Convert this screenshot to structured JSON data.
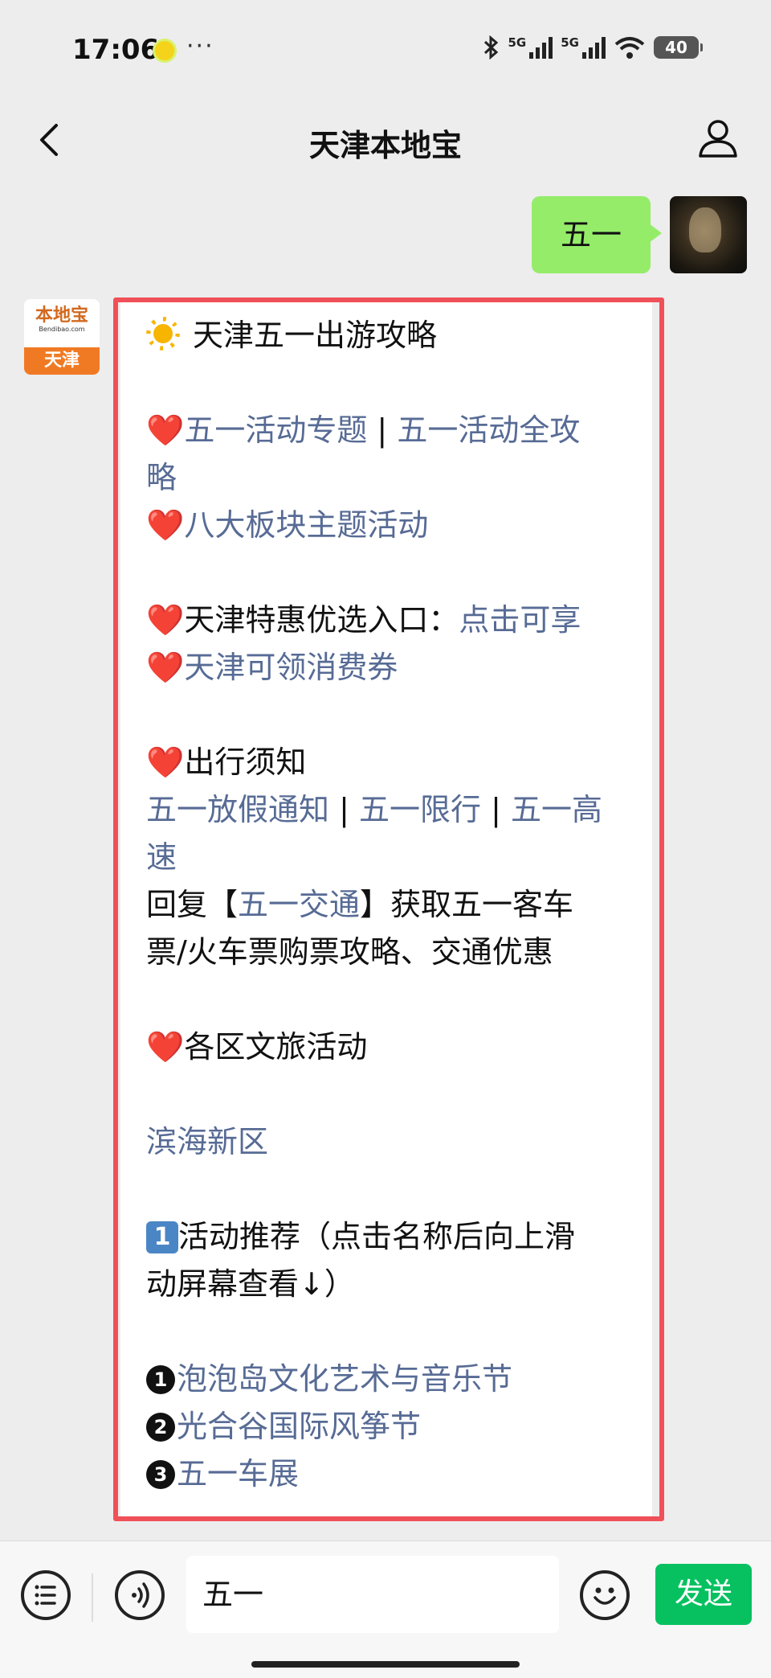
{
  "status_bar": {
    "time": "17:06",
    "network_1": "5G",
    "network_2": "5G",
    "battery": "40"
  },
  "navbar": {
    "title": "天津本地宝"
  },
  "chat": {
    "sent_message": "五一",
    "bot_avatar": {
      "logo_text": "本地宝",
      "url_text": "Bendibao.com",
      "city": "天津"
    },
    "reply": {
      "title": "天津五一出游攻略",
      "heart_glyph": "❤️",
      "topic_link": "五一活动专题",
      "separator": " | ",
      "guide_link_a": "五一活动全攻",
      "guide_link_b": "略",
      "eight_blocks_link": "八大板块主题活动",
      "discount_label": "天津特惠优选入口：",
      "discount_link": "点击可享",
      "coupon_link": "天津可领消费券",
      "travel_notice_label": "出行须知",
      "holiday_notice_link": "五一放假通知",
      "limit_link": "五一限行",
      "highway_link_a": "五一高",
      "highway_link_b": "速",
      "reply_prefix": "回复【",
      "reply_keyword": "五一交通",
      "reply_suffix_a": "】获取五一客车",
      "reply_suffix_b": "票/火车票购票攻略、交通优惠",
      "district_label": "各区文旅活动",
      "district_link": "滨海新区",
      "keycap_num": "1",
      "recommend_a": "活动推荐（点击名称后向上滑",
      "recommend_b": "动屏幕查看↓）",
      "items": [
        {
          "num": "1",
          "label": "泡泡岛文化艺术与音乐节"
        },
        {
          "num": "2",
          "label": "光合谷国际风筝节"
        },
        {
          "num": "3",
          "label": "五一车展"
        }
      ]
    }
  },
  "input_bar": {
    "text_value": "五一",
    "send_label": "发送"
  },
  "colors": {
    "bubble_green": "#95ec69",
    "link_blue": "#576b95",
    "highlight_red": "#f05058",
    "send_green": "#07c160"
  }
}
